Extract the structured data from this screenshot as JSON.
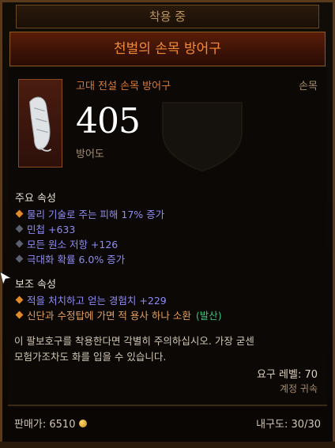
{
  "header": {
    "status_label": "착용 중",
    "item_name": "천벌의 손목 방어구"
  },
  "item": {
    "type_label": "고대 전설 손목 방어구",
    "slot_label": "손목",
    "armor_value": "405",
    "armor_label": "방어도",
    "image_icon": "bracer-icon"
  },
  "primary": {
    "title": "주요 속성",
    "attributes": [
      {
        "text": "물리 기술로 주는 피해 17% 증가",
        "bullet": "orange"
      },
      {
        "text": "민첩 +633",
        "bullet": "gray"
      },
      {
        "text": "모든 원소 저항 +126",
        "bullet": "gray"
      },
      {
        "text": "극대화 확률 6.0% 증가",
        "bullet": "gray"
      }
    ]
  },
  "secondary": {
    "title": "보조 속성",
    "attr1": "적을 처치하고 얻는 경험치 +229",
    "attr2_main": "신단과 수정탑에 가면 적 용사 하나 소환",
    "attr2_tag": "(발산)"
  },
  "flavor": {
    "line1": "이 팔보호구를 착용한다면 각별히 주의하십시오. 가장 굳센",
    "line2": "모험가조차도 화를 입을 수 있습니다."
  },
  "requirements": {
    "level": "요구 레벨: 70",
    "bound": "계정 귀속"
  },
  "footer": {
    "sell_label": "판매가: 6510",
    "durability_label": "내구도: 30/30"
  },
  "colors": {
    "title_orange": "#f28a36",
    "magic_blue": "#8f8cf5",
    "green_tag": "#3cc27a",
    "border_bronze": "#8a5a22"
  }
}
